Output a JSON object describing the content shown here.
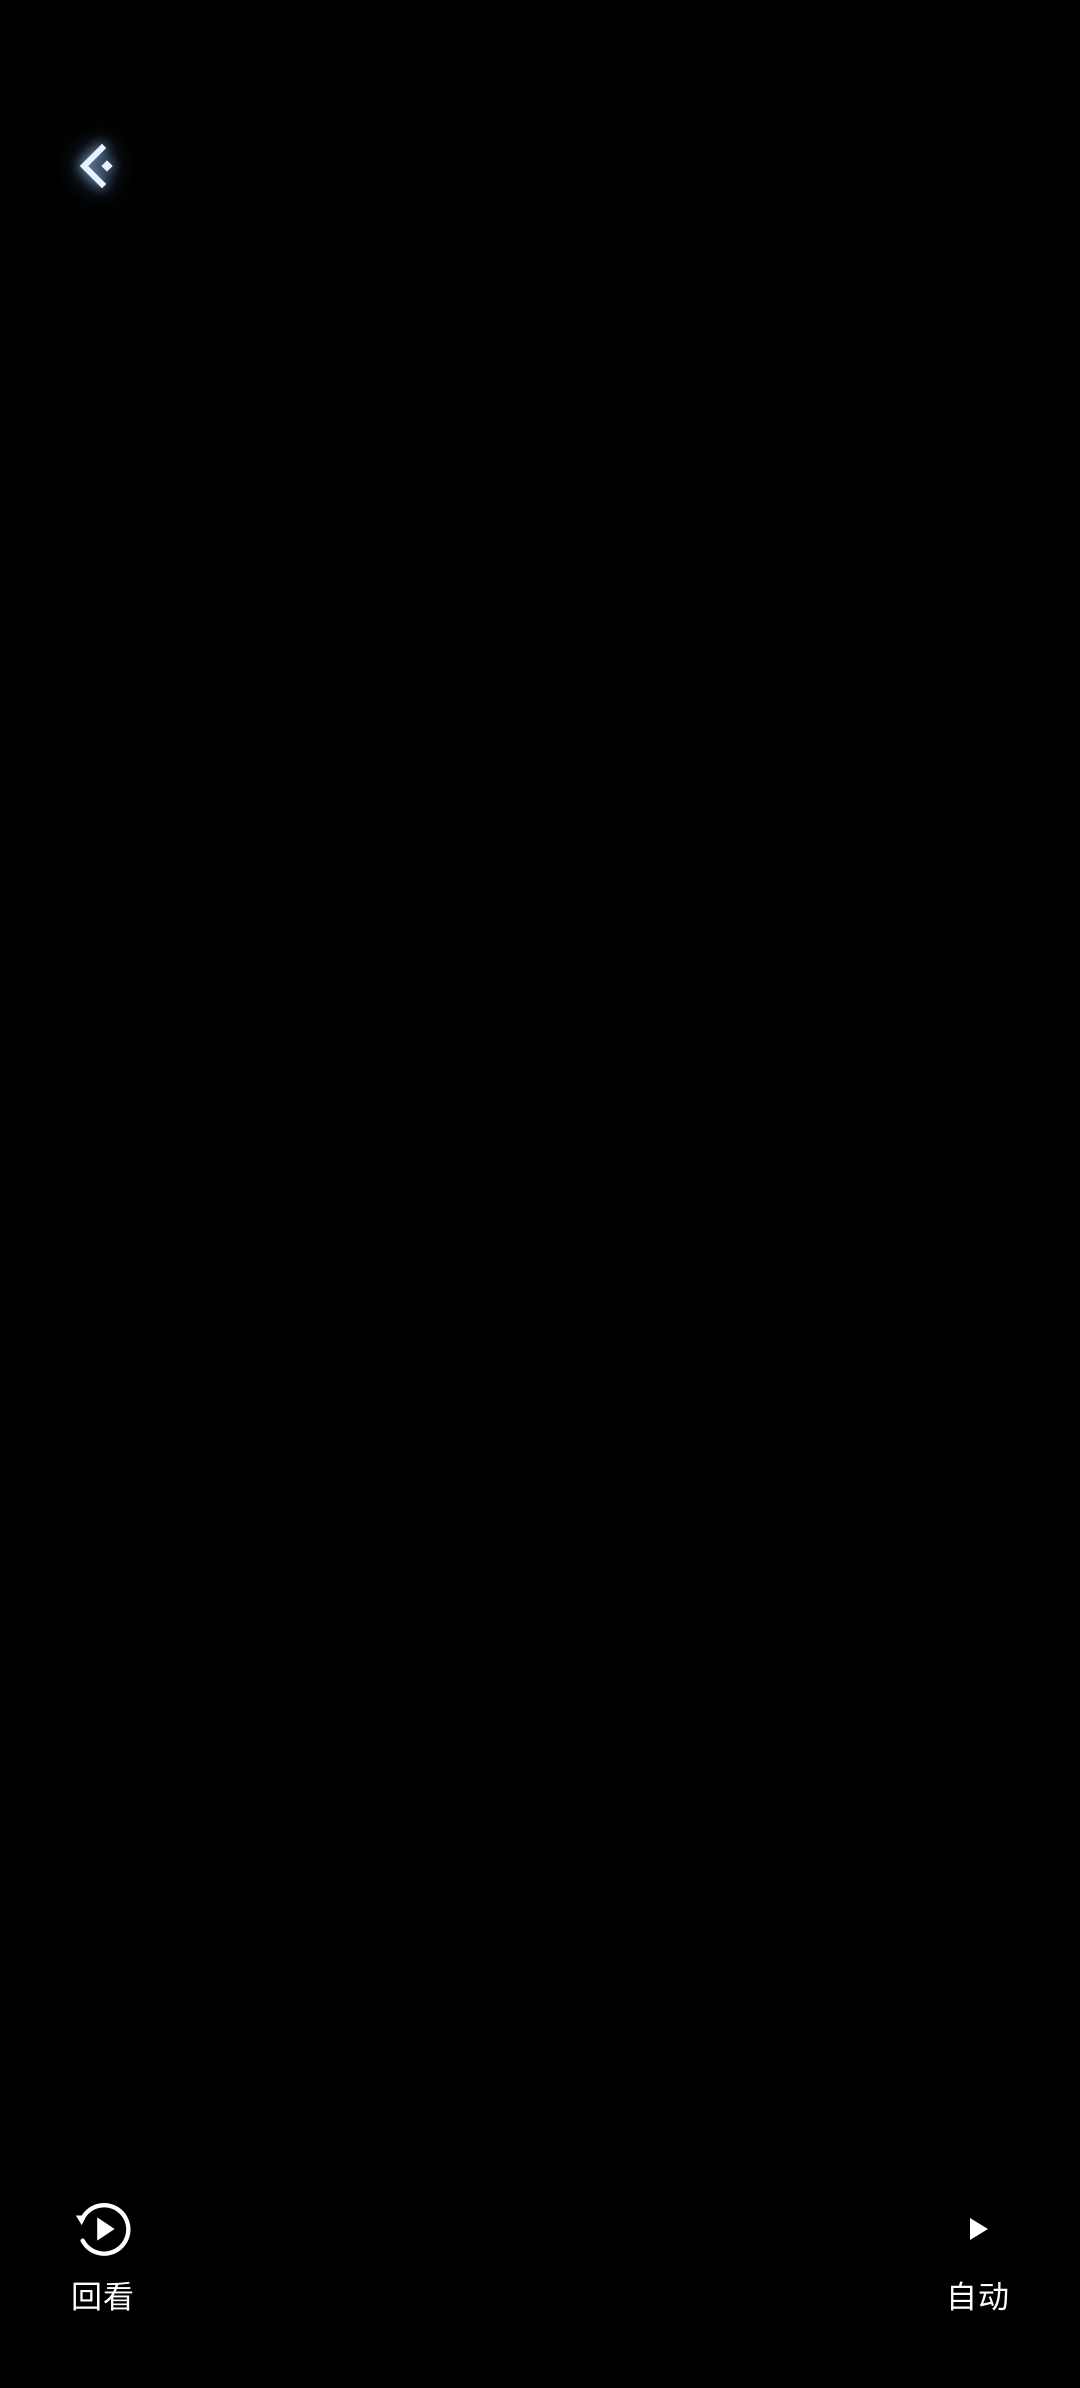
{
  "header": {
    "back_icon": "back-arrow-icon"
  },
  "bottom_bar": {
    "replay": {
      "label": "回看",
      "icon": "replay-play-icon"
    },
    "auto": {
      "label": "自动",
      "icon": "play-icon"
    }
  },
  "colors": {
    "background": "#000000",
    "text": "#ffffff",
    "back_icon": "#e6f2ff",
    "back_glow": "#8cc4ff"
  }
}
